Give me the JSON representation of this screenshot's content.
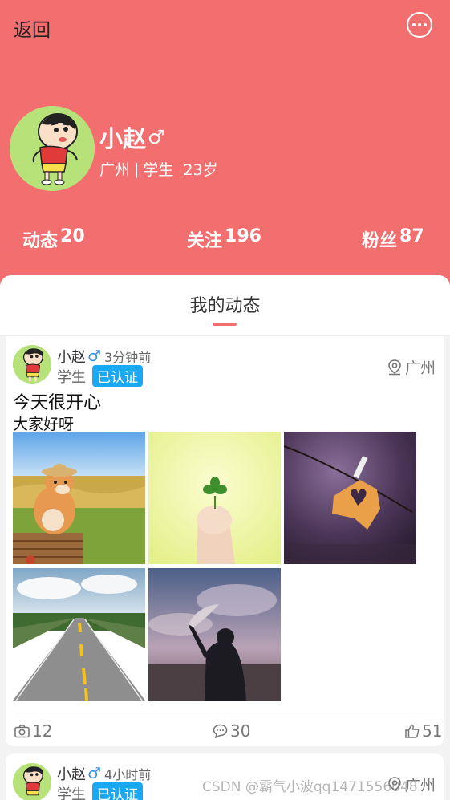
{
  "nav": {
    "back_label": "返回",
    "more_icon": "more-circle-icon"
  },
  "profile": {
    "name": "小赵",
    "gender_symbol": "♂",
    "city": "广州",
    "separator": "|",
    "role": "学生",
    "age": "23岁"
  },
  "stats": [
    {
      "label": "动态",
      "value": "20"
    },
    {
      "label": "关注",
      "value": "196"
    },
    {
      "label": "粉丝",
      "value": "87"
    }
  ],
  "tab": {
    "label": "我的动态"
  },
  "posts": [
    {
      "name": "小赵",
      "gender_symbol": "♂",
      "time": "3分钟前",
      "role": "学生",
      "badge": "已认证",
      "location": "广州",
      "text1": "今天很开心",
      "text2": "大家好呀",
      "photos": [
        "shiba-dog-photo",
        "clover-hand-photo",
        "heart-leaf-photo",
        "road-photo",
        "silhouette-photo"
      ],
      "photo_count": "12",
      "comments": "30",
      "likes": "51"
    },
    {
      "name": "小赵",
      "gender_symbol": "♂",
      "time": "4小时前",
      "role": "学生",
      "badge": "已认证",
      "location": "广州"
    }
  ],
  "watermark": "CSDN @霸气小波qq1471556048",
  "colors": {
    "header": "#f36e6e",
    "badge": "#19a8f2",
    "male": "#3a8ee6"
  }
}
